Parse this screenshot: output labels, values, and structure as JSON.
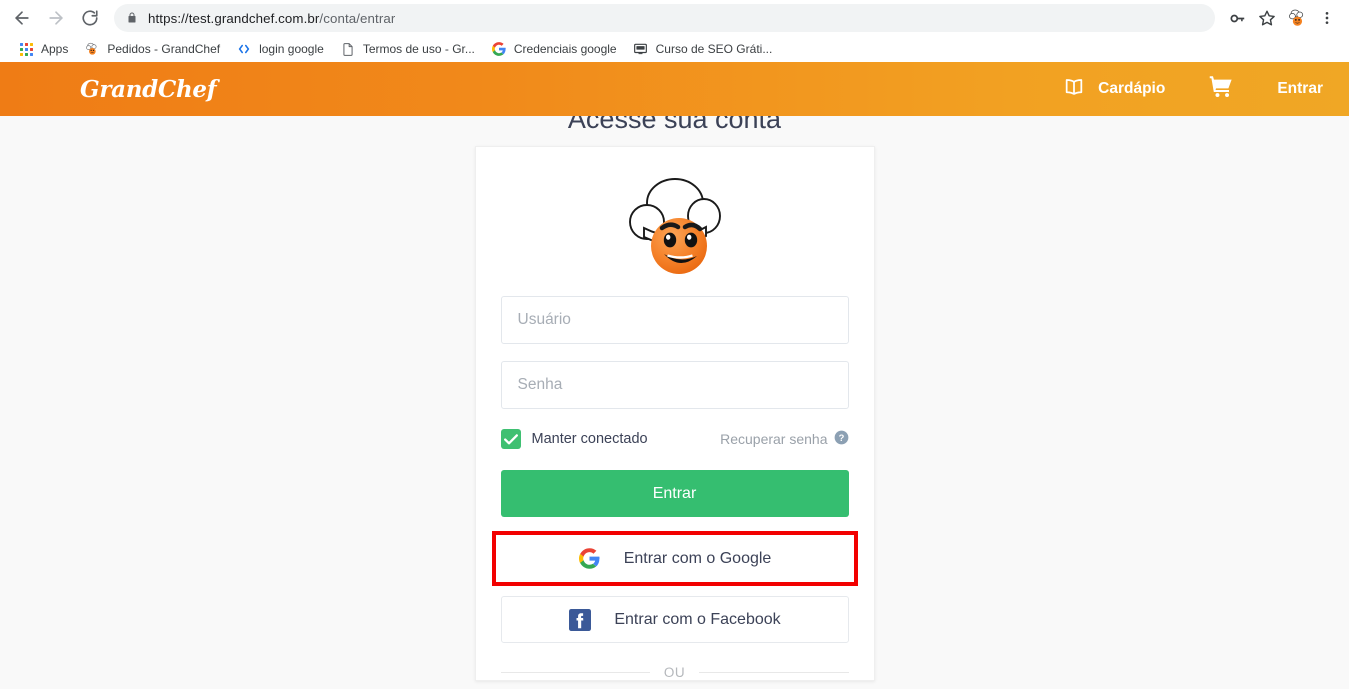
{
  "browser": {
    "back_label": "Back",
    "forward_label": "Forward",
    "reload_label": "Reload",
    "url_domain": "https://test.grandchef.com.br",
    "url_path": "/conta/entrar",
    "lock_icon": "lock-icon",
    "save_password_icon": "key-icon",
    "bookmark_icon": "star-icon",
    "profile_icon": "profile-avatar-icon",
    "menu_icon": "three-dot-menu-icon",
    "bookmarks": [
      {
        "label": "Apps",
        "icon": "apps-grid-icon"
      },
      {
        "label": "Pedidos - GrandChef",
        "icon": "grandchef-favicon"
      },
      {
        "label": "login google",
        "icon": "code-brackets-icon"
      },
      {
        "label": "Termos de uso - Gr...",
        "icon": "document-icon"
      },
      {
        "label": "Credenciais google",
        "icon": "google-g-icon"
      },
      {
        "label": "Curso de SEO Gráti...",
        "icon": "monitor-icon"
      }
    ]
  },
  "site_header": {
    "brand": "GrandChef",
    "nav": [
      {
        "label": "Cardápio",
        "icon": "open-book-icon"
      },
      {
        "label": "",
        "icon": "shopping-cart-icon"
      },
      {
        "label": "Entrar",
        "icon": ""
      }
    ],
    "gradient_start": "#ef7c15",
    "gradient_end": "#f0a725"
  },
  "page": {
    "title": "Acesse sua conta",
    "background": "#f9f9f9"
  },
  "login_form": {
    "mascot_icon": "grandchef-chef-mascot-icon",
    "username_placeholder": "Usuário",
    "username_value": "",
    "password_placeholder": "Senha",
    "password_value": "",
    "keep_connected_label": "Manter conectado",
    "keep_connected_checked": true,
    "recover_label": "Recuperar senha",
    "recover_help_icon": "question-mark-circle-icon",
    "submit_label": "Entrar",
    "google_label": "Entrar com o Google",
    "google_icon": "google-g-icon",
    "facebook_label": "Entrar com o Facebook",
    "facebook_icon": "facebook-f-icon",
    "divider_label": "OU",
    "primary_color": "#35be70",
    "checkbox_color": "#3fc072"
  },
  "annotation": {
    "highlight_target": "google-login-button",
    "highlight_color": "#f20000"
  }
}
